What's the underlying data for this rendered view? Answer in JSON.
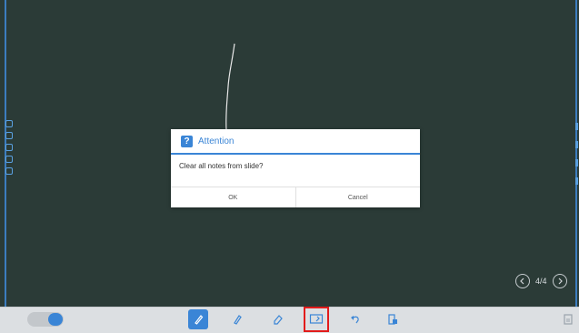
{
  "dialog": {
    "title": "Attention",
    "message": "Clear all notes from slide?",
    "ok_label": "OK",
    "cancel_label": "Cancel"
  },
  "pager": {
    "page": "4/4"
  },
  "toolbar": {
    "tools": [
      {
        "icon": "pen-icon",
        "active": true
      },
      {
        "icon": "highlighter-icon"
      },
      {
        "icon": "eraser-icon"
      },
      {
        "icon": "clear-slide-icon",
        "selected": true
      },
      {
        "icon": "undo-icon"
      },
      {
        "icon": "export-icon"
      },
      {
        "icon": "save-icon"
      }
    ]
  },
  "colors": {
    "board": "#2b3b37",
    "accent": "#3a85d6",
    "highlight": "#e21b1b"
  }
}
